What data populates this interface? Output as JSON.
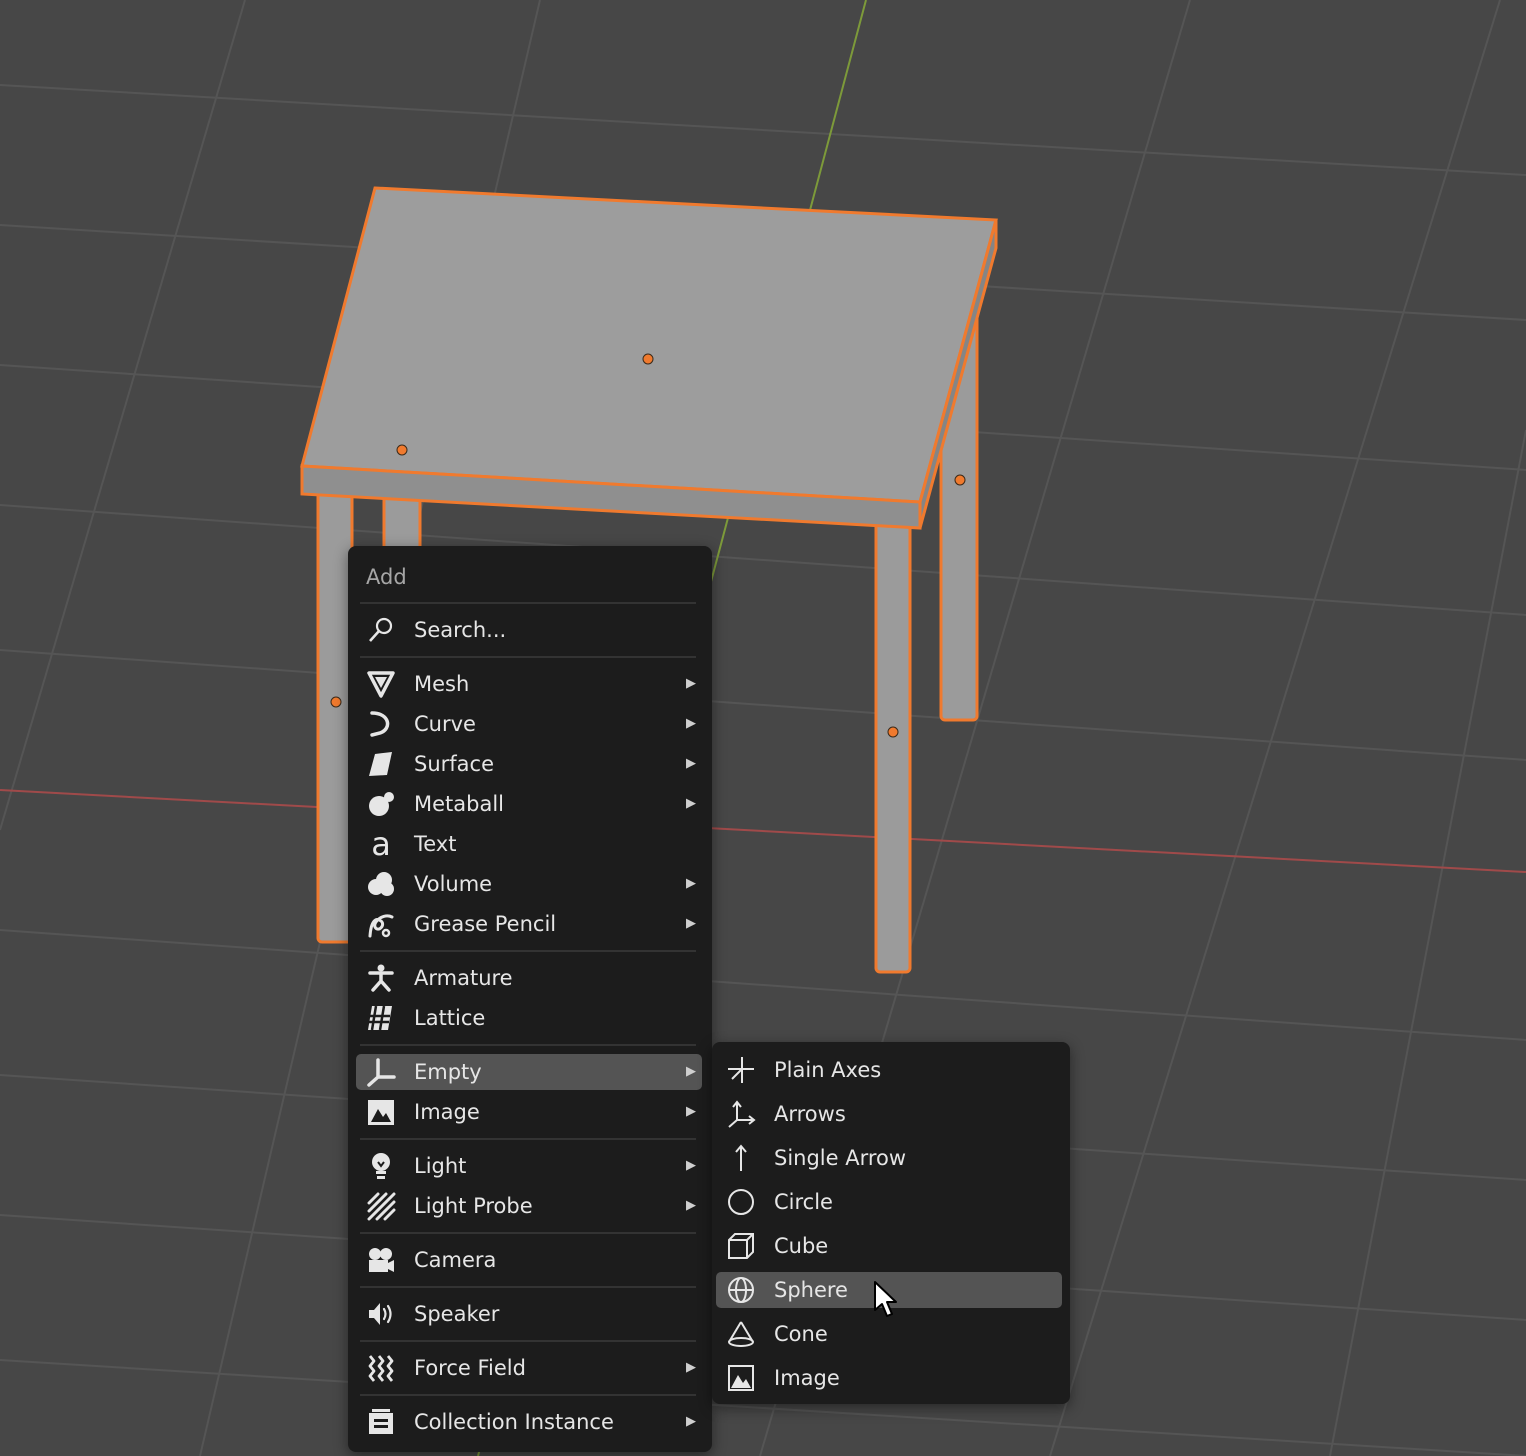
{
  "add_menu": {
    "title": "Add",
    "search": {
      "label": "Search...",
      "icon": "search-icon"
    },
    "items": [
      {
        "label": "Mesh",
        "icon": "mesh-icon",
        "submenu": true
      },
      {
        "label": "Curve",
        "icon": "curve-icon",
        "submenu": true
      },
      {
        "label": "Surface",
        "icon": "surface-icon",
        "submenu": true
      },
      {
        "label": "Metaball",
        "icon": "metaball-icon",
        "submenu": true
      },
      {
        "label": "Text",
        "icon": "text-icon",
        "submenu": false
      },
      {
        "label": "Volume",
        "icon": "volume-icon",
        "submenu": true
      },
      {
        "label": "Grease Pencil",
        "icon": "grease-pencil-icon",
        "submenu": true
      },
      {
        "label": "Armature",
        "icon": "armature-icon",
        "submenu": false
      },
      {
        "label": "Lattice",
        "icon": "lattice-icon",
        "submenu": false
      },
      {
        "label": "Empty",
        "icon": "empty-icon",
        "submenu": true,
        "active": true
      },
      {
        "label": "Image",
        "icon": "image-icon",
        "submenu": true
      },
      {
        "label": "Light",
        "icon": "light-icon",
        "submenu": true
      },
      {
        "label": "Light Probe",
        "icon": "light-probe-icon",
        "submenu": true
      },
      {
        "label": "Camera",
        "icon": "camera-icon",
        "submenu": false
      },
      {
        "label": "Speaker",
        "icon": "speaker-icon",
        "submenu": false
      },
      {
        "label": "Force Field",
        "icon": "force-field-icon",
        "submenu": true
      },
      {
        "label": "Collection Instance",
        "icon": "collection-instance-icon",
        "submenu": true
      }
    ]
  },
  "empty_submenu": {
    "items": [
      {
        "label": "Plain Axes",
        "icon": "plain-axes-icon"
      },
      {
        "label": "Arrows",
        "icon": "arrows-icon"
      },
      {
        "label": "Single Arrow",
        "icon": "single-arrow-icon"
      },
      {
        "label": "Circle",
        "icon": "circle-icon"
      },
      {
        "label": "Cube",
        "icon": "cube-icon"
      },
      {
        "label": "Sphere",
        "icon": "sphere-icon",
        "hovered": true
      },
      {
        "label": "Cone",
        "icon": "cone-icon"
      },
      {
        "label": "Image",
        "icon": "image-icon"
      }
    ]
  },
  "colors": {
    "viewport_bg": "#474747",
    "grid_line": "#555555",
    "x_axis": "#a04a4a",
    "y_axis": "#7d9a3a",
    "selection_outline": "#f07a2e",
    "object_fill": "#9b9b9b",
    "menu_bg": "#1c1c1c",
    "menu_highlight": "#545454",
    "menu_text": "#e6e6e6"
  }
}
